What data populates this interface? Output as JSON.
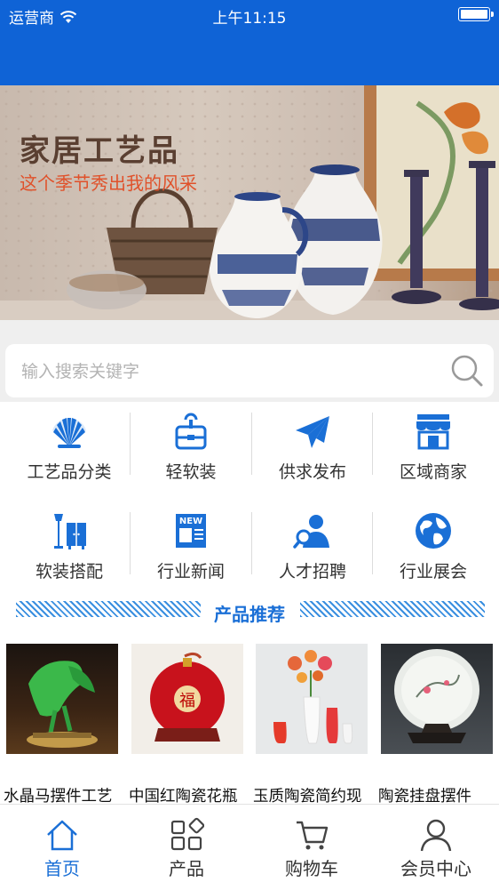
{
  "status_bar": {
    "carrier": "运营商",
    "time": "上午11:15"
  },
  "banner": {
    "title": "家居工艺品",
    "subtitle": "这个季节秀出我的风采"
  },
  "search": {
    "placeholder": "输入搜索关键字"
  },
  "categories": [
    {
      "label": "工艺品分类",
      "icon": "fan-icon"
    },
    {
      "label": "轻软装",
      "icon": "briefcase-icon"
    },
    {
      "label": "供求发布",
      "icon": "paper-plane-icon"
    },
    {
      "label": "区域商家",
      "icon": "storefront-icon"
    },
    {
      "label": "软装搭配",
      "icon": "lamp-cabinet-icon"
    },
    {
      "label": "行业新闻",
      "icon": "news-icon"
    },
    {
      "label": "人才招聘",
      "icon": "person-search-icon"
    },
    {
      "label": "行业展会",
      "icon": "globe-icon"
    }
  ],
  "section": {
    "title": "产品推荐"
  },
  "products": [
    {
      "name": "水晶马摆件工艺"
    },
    {
      "name": "中国红陶瓷花瓶"
    },
    {
      "name": "玉质陶瓷简约现"
    },
    {
      "name": "陶瓷挂盘摆件"
    }
  ],
  "tabbar": [
    {
      "label": "首页",
      "icon": "home-icon",
      "active": true
    },
    {
      "label": "产品",
      "icon": "grid-icon",
      "active": false
    },
    {
      "label": "购物车",
      "icon": "cart-icon",
      "active": false
    },
    {
      "label": "会员中心",
      "icon": "user-icon",
      "active": false
    }
  ],
  "colors": {
    "brand": "#0f63d6",
    "accent": "#1a6fd6",
    "subtitle": "#e0512a"
  }
}
